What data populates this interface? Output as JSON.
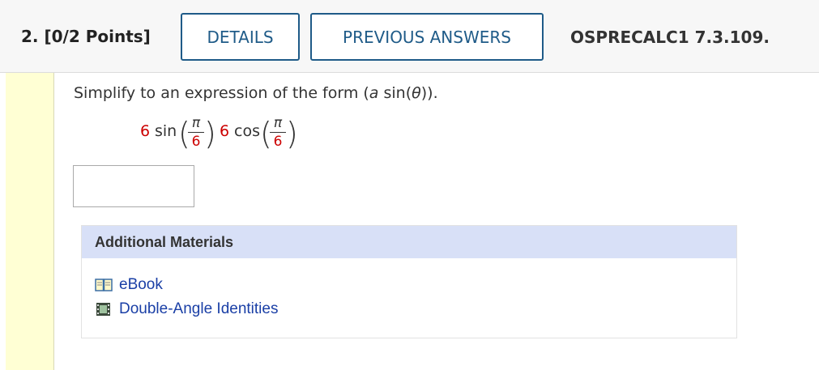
{
  "question": {
    "number_label": "2.",
    "points_label": "[0/2 Points]",
    "details_label": "DETAILS",
    "previous_answers_label": "PREVIOUS ANSWERS",
    "problem_code": "OSPRECALC1 7.3.109."
  },
  "prompt": {
    "prefix": "Simplify to an expression of the form (",
    "var_a": "a",
    "middle": " sin(",
    "var_theta": "θ",
    "suffix": "))."
  },
  "expression": {
    "coef1": "6",
    "fn1": "sin",
    "num1": "π",
    "den1": "6",
    "coef2": "6",
    "fn2": "cos",
    "num2": "π",
    "den2": "6"
  },
  "answer": {
    "value": ""
  },
  "materials": {
    "heading": "Additional Materials",
    "items": [
      {
        "label": "eBook",
        "icon": "book-icon"
      },
      {
        "label": "Double-Angle Identities",
        "icon": "film-icon"
      }
    ]
  },
  "colors": {
    "accent": "#1f5b88",
    "highlight_red": "#cc0000",
    "materials_header": "#d8e0f7",
    "left_bar": "#ffffd4",
    "link": "#1a3fa6"
  }
}
